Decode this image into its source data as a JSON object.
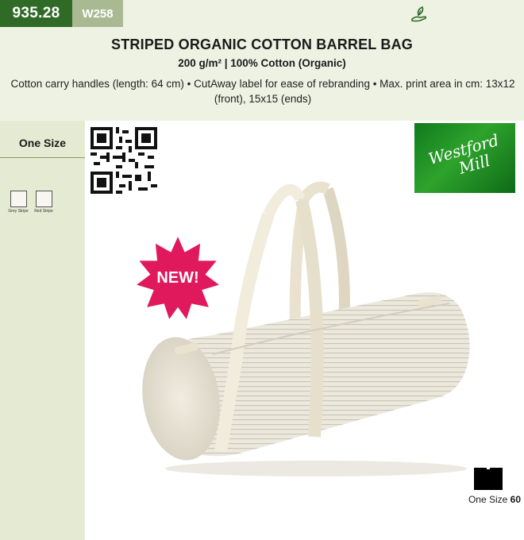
{
  "product": {
    "code": "935.28",
    "sku": "W258",
    "title": "STRIPED ORGANIC COTTON BARREL BAG",
    "subtitle": "200 g/m² | 100% Cotton (Organic)",
    "description": "Cotton carry handles (length: 64 cm) • CutAway label for ease of rebranding • Max. print area in cm: 13x12 (front), 15x15 (ends)"
  },
  "sidebar": {
    "size_label": "One Size",
    "swatches": [
      {
        "label": "Grey Stripe",
        "color": "#f7f6f0"
      },
      {
        "label": "Red Stripe",
        "color": "#f7f6f0"
      }
    ]
  },
  "badges": {
    "new_label": "NEW!"
  },
  "brand": {
    "logo_line1": "Westford",
    "logo_line2": "Mill"
  },
  "size_info": {
    "size": "One Size",
    "quantity": "60"
  },
  "icons": {
    "eco": "eco-hand-leaf-icon",
    "qr": "qr-code-icon",
    "carton": "carton-box-icon"
  },
  "colors": {
    "accent_green": "#2f6b27",
    "light_green": "#a9ba93",
    "band_bg": "#eef2e3",
    "sidebar_bg": "#e4ebd2",
    "new_badge": "#e0185c"
  }
}
